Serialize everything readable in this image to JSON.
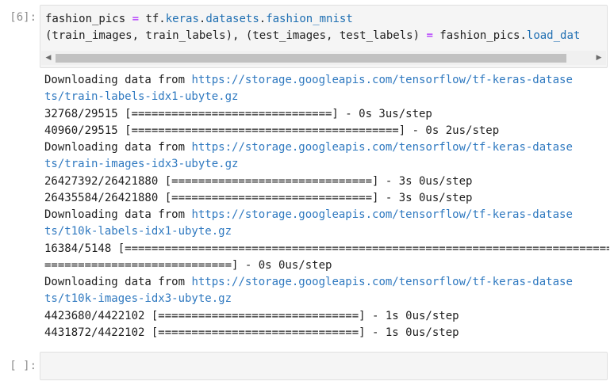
{
  "cells": {
    "code_cell": {
      "prompt": "[6]:",
      "line1": {
        "var": "fashion_pics ",
        "op": "=",
        "pre": " tf.",
        "a1": "keras",
        "d1": ".",
        "a2": "datasets",
        "d2": ".",
        "a3": "fashion_mnist"
      },
      "line2": {
        "text": "(train_images, train_labels), (test_images, test_labels) ",
        "op": "=",
        "post": " fashion_pics.",
        "attr": "load_dat"
      }
    },
    "output": [
      {
        "pre": "Downloading data from ",
        "link": "https://storage.googleapis.com/tensorflow/tf-keras-datase"
      },
      {
        "pre": "",
        "link": "ts/train-labels-idx1-ubyte.gz"
      },
      {
        "pre": "32768/29515 [==============================] - 0s 3us/step",
        "link": ""
      },
      {
        "pre": "40960/29515 [========================================] - 0s 2us/step",
        "link": ""
      },
      {
        "pre": "Downloading data from ",
        "link": "https://storage.googleapis.com/tensorflow/tf-keras-datase"
      },
      {
        "pre": "",
        "link": "ts/train-images-idx3-ubyte.gz"
      },
      {
        "pre": "26427392/26421880 [==============================] - 3s 0us/step",
        "link": ""
      },
      {
        "pre": "26435584/26421880 [==============================] - 3s 0us/step",
        "link": ""
      },
      {
        "pre": "Downloading data from ",
        "link": "https://storage.googleapis.com/tensorflow/tf-keras-datase"
      },
      {
        "pre": "",
        "link": "ts/t10k-labels-idx1-ubyte.gz"
      },
      {
        "pre": "16384/5148 [=========================================================================",
        "link": ""
      },
      {
        "pre": "============================] - 0s 0us/step",
        "link": ""
      },
      {
        "pre": "Downloading data from ",
        "link": "https://storage.googleapis.com/tensorflow/tf-keras-datase"
      },
      {
        "pre": "",
        "link": "ts/t10k-images-idx3-ubyte.gz"
      },
      {
        "pre": "4423680/4422102 [==============================] - 1s 0us/step",
        "link": ""
      },
      {
        "pre": "4431872/4422102 [==============================] - 1s 0us/step",
        "link": ""
      }
    ],
    "empty_cell": {
      "prompt": "[ ]:"
    }
  },
  "scrollbar": {
    "left_arrow": "◀",
    "right_arrow": "▶"
  },
  "colors": {
    "prompt": "#8c8c8c",
    "link": "#2f79c0",
    "operator": "#aa22ff",
    "attribute": "#1f6fb2",
    "cell_background": "#f5f5f5"
  }
}
